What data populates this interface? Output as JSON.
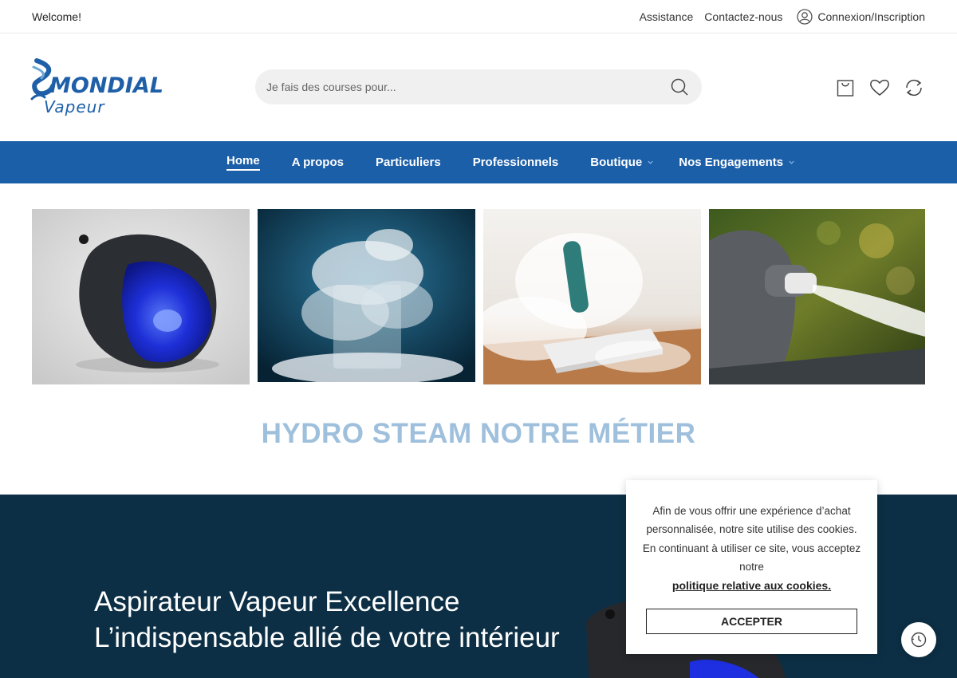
{
  "topbar": {
    "welcome": "Welcome!",
    "assistance": "Assistance",
    "contact": "Contactez-nous",
    "login": "Connexion/Inscription"
  },
  "header": {
    "logo_brand": "MONDIAL",
    "logo_sub": "Vapeur",
    "search_placeholder": "Je fais des courses pour...",
    "icons": [
      "shopping-bag-icon",
      "heart-icon",
      "compare-icon"
    ]
  },
  "nav": {
    "items": [
      {
        "label": "Home",
        "active": true
      },
      {
        "label": "A propos"
      },
      {
        "label": "Particuliers"
      },
      {
        "label": "Professionnels"
      },
      {
        "label": "Boutique",
        "has_dropdown": true
      },
      {
        "label": "Nos Engagements",
        "has_dropdown": true
      }
    ]
  },
  "gallery": {
    "images": [
      "steam-vacuum-image",
      "dry-ice-glass-image",
      "steam-mop-image",
      "steam-nozzle-image"
    ]
  },
  "tagline": "HYDRO STEAM NOTRE MÉTIER",
  "hero": {
    "line1": "Aspirateur Vapeur Excellence",
    "line2": "L’indispensable allié de votre intérieur"
  },
  "cookie": {
    "message": "Afin de vous offrir une expérience d’achat personnalisée, notre site utilise des cookies. En continuant à utiliser ce site, vous acceptez notre",
    "policy_link": "politique relative aux cookies.",
    "accept_label": "ACCEPTER"
  },
  "colors": {
    "primary": "#1c5fa9",
    "hero_bg": "#0c2f45",
    "tagline": "#9fc0dc"
  }
}
